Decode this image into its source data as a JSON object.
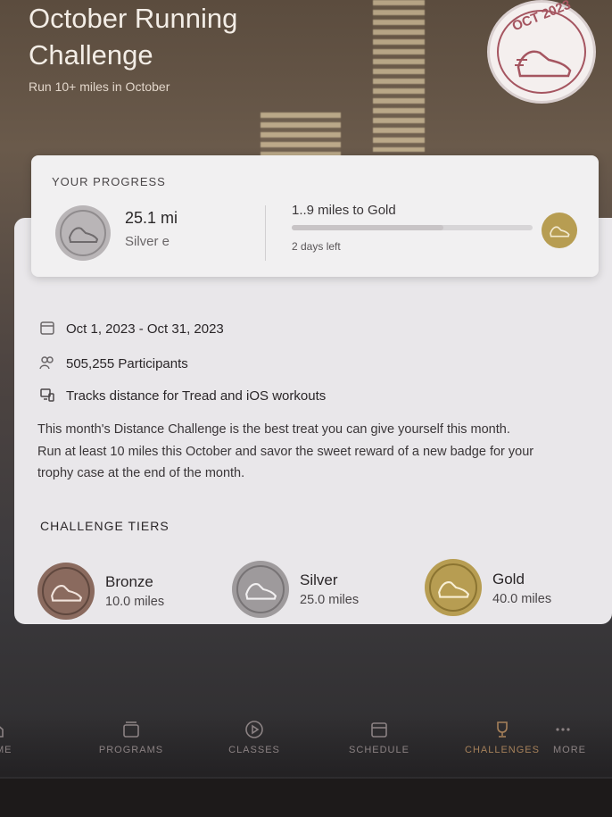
{
  "header": {
    "title": "October Running Challenge",
    "subtitle": "Run 10+ miles in October",
    "badge_text": "OCT 2023"
  },
  "progress": {
    "section_title": "YOUR PROGRESS",
    "miles": "25.1 mi",
    "earned": "Silver e",
    "to_gold": "1..9 miles to Gold",
    "days_left": "2 days left",
    "bar_fraction": 0.63
  },
  "details": {
    "date_range": "Oct 1, 2023 - Oct 31, 2023",
    "participants": "505,255 Participants",
    "tracks": "Tracks distance for Tread and iOS workouts",
    "description": "This month's Distance Challenge is the best treat you can give yourself this month. Run at least 10 miles this October and savor the sweet reward of a new badge for your trophy case at the end of the month."
  },
  "tiers": {
    "title": "CHALLENGE TIERS",
    "items": [
      {
        "name": "Bronze",
        "miles": "10.0 miles",
        "color": "#8a6a5e"
      },
      {
        "name": "Silver",
        "miles": "25.0 miles",
        "color": "#9e9a9c"
      },
      {
        "name": "Gold",
        "miles": "40.0 miles",
        "color": "#b79d52"
      }
    ]
  },
  "nav": {
    "items": [
      {
        "label": "HOME",
        "icon": "home-icon"
      },
      {
        "label": "PROGRAMS",
        "icon": "programs-icon"
      },
      {
        "label": "CLASSES",
        "icon": "play-icon"
      },
      {
        "label": "SCHEDULE",
        "icon": "calendar-icon"
      },
      {
        "label": "CHALLENGES",
        "icon": "trophy-icon"
      },
      {
        "label": "MORE",
        "icon": "more-icon"
      }
    ]
  },
  "colors": {
    "accent": "#a55560",
    "card": "#e9e7ea",
    "bronze": "#8a6a5e",
    "silver": "#9e9a9c",
    "gold": "#b79d52"
  }
}
